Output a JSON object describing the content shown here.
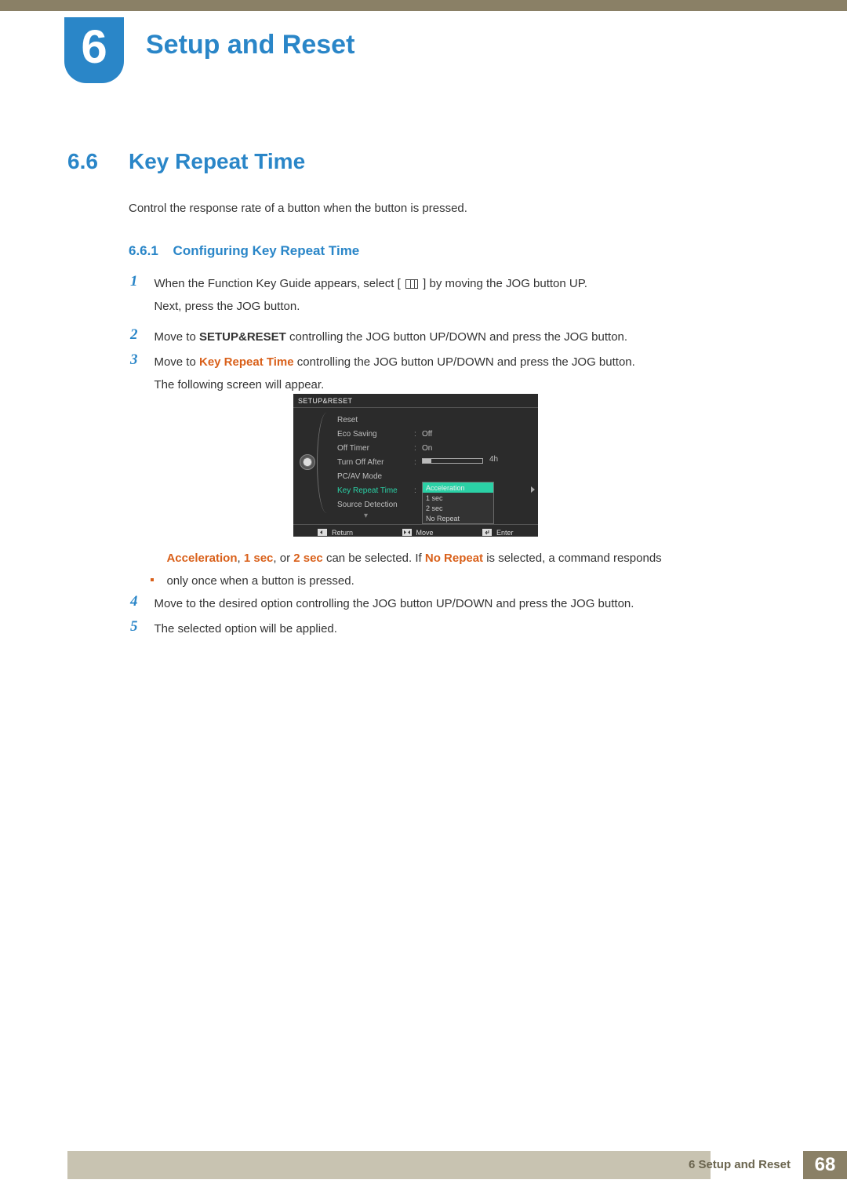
{
  "chapter": {
    "num": "6",
    "title": "Setup and Reset"
  },
  "section": {
    "num": "6.6",
    "title": "Key Repeat Time"
  },
  "intro": "Control the response rate of a button when the button is pressed.",
  "subsection": {
    "num": "6.6.1",
    "title": "Configuring Key Repeat Time"
  },
  "steps": {
    "s1a": "When the Function Key Guide appears, select [",
    "s1b": "] by moving the JOG button UP.",
    "s1c": "Next, press the JOG button.",
    "s2a": "Move to ",
    "s2_bold": "SETUP&RESET",
    "s2b": " controlling the JOG button UP/DOWN and press the JOG button.",
    "s3a": "Move to ",
    "s3_orange": "Key Repeat Time",
    "s3b": " controlling the JOG button UP/DOWN and press the JOG button.",
    "s3c": "The following screen will appear.",
    "s4": "Move to the desired option controlling the JOG button UP/DOWN and press the JOG button.",
    "s5": "The selected option will be applied."
  },
  "bullet": {
    "a": "Acceleration",
    "comma1": ", ",
    "b": "1 sec",
    "mid": ", or ",
    "c": "2 sec",
    "d": " can be selected. If ",
    "e": "No Repeat",
    "f": " is selected, a command responds",
    "g": "only once when a button is pressed."
  },
  "osd": {
    "title": "SETUP&RESET",
    "rows": [
      {
        "label": "Reset",
        "val": ""
      },
      {
        "label": "Eco Saving",
        "val": "Off"
      },
      {
        "label": "Off Timer",
        "val": "On"
      },
      {
        "label": "Turn Off After",
        "val": ""
      },
      {
        "label": "PC/AV Mode",
        "val": ""
      },
      {
        "label": "Key Repeat Time",
        "val": ""
      },
      {
        "label": "Source Detection",
        "val": ""
      }
    ],
    "slider_label": "4h",
    "dropdown": [
      "Acceleration",
      "1 sec",
      "2 sec",
      "No Repeat"
    ],
    "footer": {
      "return": "Return",
      "move": "Move",
      "enter": "Enter"
    }
  },
  "footer": {
    "label": "6 Setup and Reset",
    "page": "68"
  },
  "step_nums": {
    "n1": "1",
    "n2": "2",
    "n3": "3",
    "n4": "4",
    "n5": "5"
  }
}
